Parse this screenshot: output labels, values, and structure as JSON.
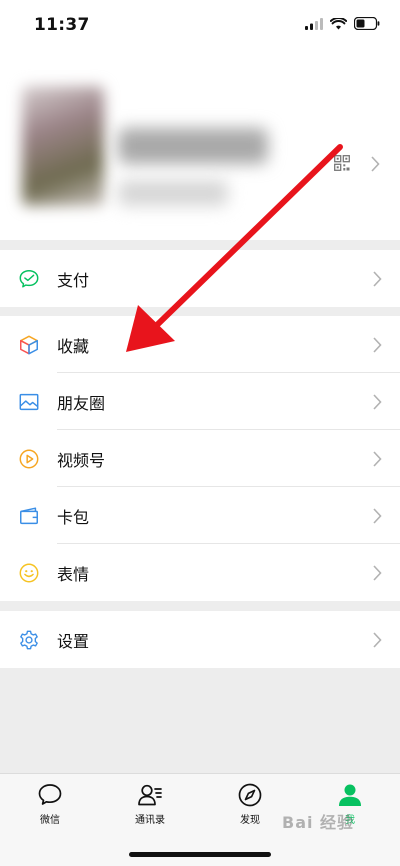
{
  "status_bar": {
    "time": "11:37"
  },
  "menu": {
    "pay": {
      "label": "支付"
    },
    "favorites": {
      "label": "收藏"
    },
    "moments": {
      "label": "朋友圈"
    },
    "channels": {
      "label": "视频号"
    },
    "cards": {
      "label": "卡包"
    },
    "stickers": {
      "label": "表情"
    },
    "settings": {
      "label": "设置"
    }
  },
  "tabbar": {
    "chats": "微信",
    "contacts": "通讯录",
    "discover": "发现",
    "me": "我",
    "active": "me"
  },
  "watermark": {
    "text": "Bai 经验"
  },
  "colors": {
    "accent_green": "#07c160",
    "arrow_red": "#e8141c"
  }
}
